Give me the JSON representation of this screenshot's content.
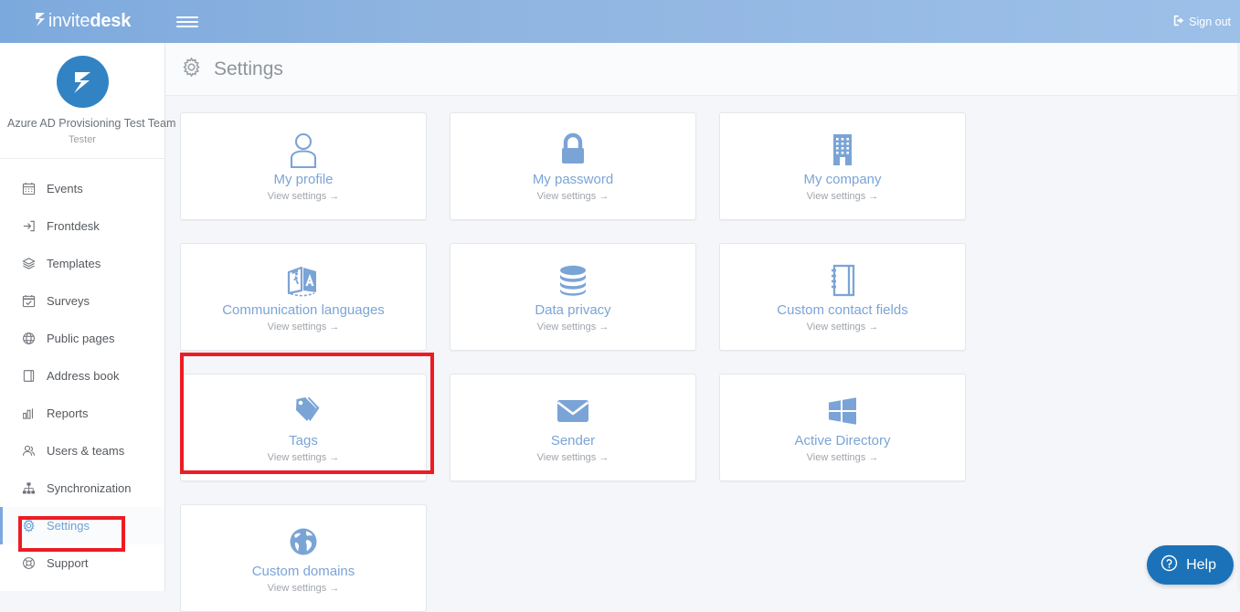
{
  "brand": {
    "name_light": "invite",
    "name_bold": "desk",
    "logo_icon": "invitedesk-logo-icon",
    "accent": "#7ba4d6",
    "header_blue": "#8fb4e0",
    "avatar_blue": "#3183c4",
    "annotation_red": "#ec1c24",
    "help_blue": "#1b72b8"
  },
  "topbar": {
    "menu_icon": "hamburger-menu-icon",
    "signout_icon": "sign-out-icon",
    "signout_label": "Sign out"
  },
  "sidebar": {
    "profile": {
      "avatar_icon": "company-avatar-icon",
      "name": "Azure AD Provisioning Test Team",
      "role": "Tester"
    },
    "items": [
      {
        "label": "Events",
        "icon": "calendar-icon",
        "active": false
      },
      {
        "label": "Frontdesk",
        "icon": "login-arrow-icon",
        "active": false
      },
      {
        "label": "Templates",
        "icon": "layers-icon",
        "active": false
      },
      {
        "label": "Surveys",
        "icon": "survey-check-icon",
        "active": false
      },
      {
        "label": "Public pages",
        "icon": "globe-icon",
        "active": false
      },
      {
        "label": "Address book",
        "icon": "address-book-icon",
        "active": false
      },
      {
        "label": "Reports",
        "icon": "bar-chart-icon",
        "active": false
      },
      {
        "label": "Users & teams",
        "icon": "users-icon",
        "active": false
      },
      {
        "label": "Synchronization",
        "icon": "sitemap-icon",
        "active": false
      },
      {
        "label": "Settings",
        "icon": "gear-icon",
        "active": true
      },
      {
        "label": "Support",
        "icon": "lifebuoy-icon",
        "active": false
      }
    ]
  },
  "page": {
    "title": "Settings",
    "title_icon": "gear-icon"
  },
  "cards": [
    {
      "title": "My profile",
      "sub": "View settings →",
      "icon": "user-icon"
    },
    {
      "title": "My password",
      "sub": "View settings →",
      "icon": "lock-icon"
    },
    {
      "title": "My company",
      "sub": "View settings →",
      "icon": "building-icon"
    },
    {
      "title": "Communication languages",
      "sub": "View settings →",
      "icon": "translate-icon"
    },
    {
      "title": "Data privacy",
      "sub": "View settings →",
      "icon": "database-icon"
    },
    {
      "title": "Custom contact fields",
      "sub": "View settings →",
      "icon": "notebook-icon"
    },
    {
      "title": "Tags",
      "sub": "View settings →",
      "icon": "tags-icon"
    },
    {
      "title": "Sender",
      "sub": "View settings →",
      "icon": "envelope-icon"
    },
    {
      "title": "Active Directory",
      "sub": "View settings →",
      "icon": "windows-icon"
    },
    {
      "title": "Custom domains",
      "sub": "View settings →",
      "icon": "globe-solid-icon"
    }
  ],
  "help": {
    "label": "Help",
    "icon": "question-circle-icon"
  },
  "annotations": [
    {
      "name": "active-directory-card-highlight"
    },
    {
      "name": "settings-nav-highlight"
    }
  ]
}
